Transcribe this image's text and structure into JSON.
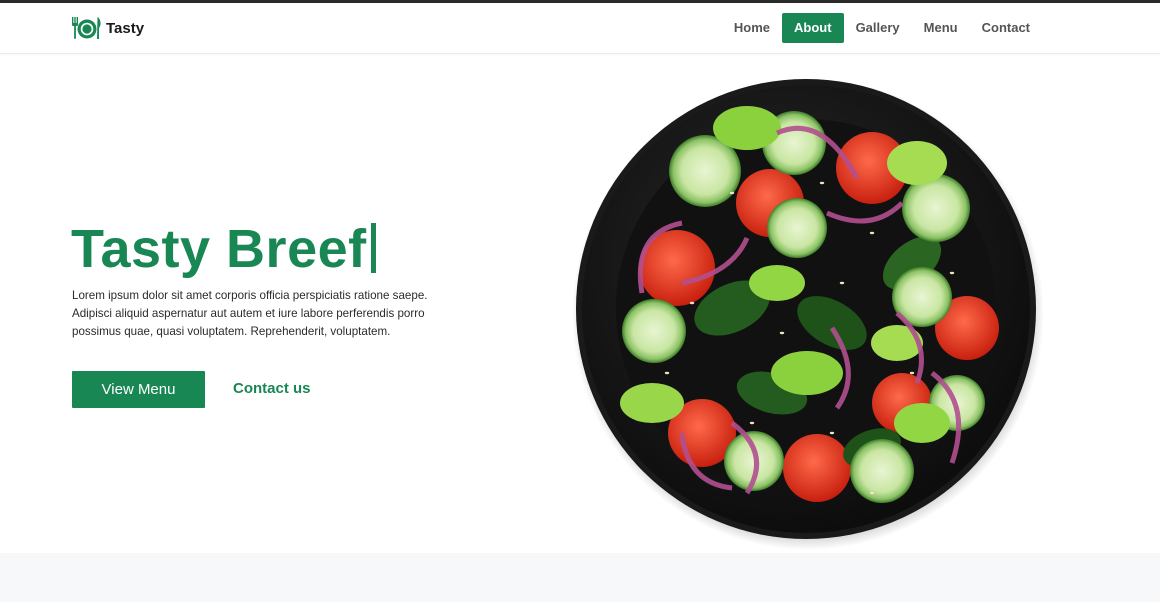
{
  "brand": {
    "name": "Tasty",
    "icon": "plate-fork-knife-icon"
  },
  "nav": {
    "items": [
      {
        "label": "Home"
      },
      {
        "label": "About",
        "active": true
      },
      {
        "label": "Gallery"
      },
      {
        "label": "Menu"
      },
      {
        "label": "Contact"
      }
    ]
  },
  "hero": {
    "title": "Tasty Breef",
    "description": "Lorem ipsum dolor sit amet corporis officia perspiciatis ratione saepe. Adipisci aliquid aspernatur aut autem et iure labore perferendis porro possimus quae, quasi voluptatem. Reprehenderit, voluptatem.",
    "primary_button": "View Menu",
    "secondary_link": "Contact us"
  },
  "colors": {
    "accent": "#198754",
    "topbar": "#2a2a2a",
    "nav_text": "#555555",
    "band": "#f7f8fa"
  }
}
